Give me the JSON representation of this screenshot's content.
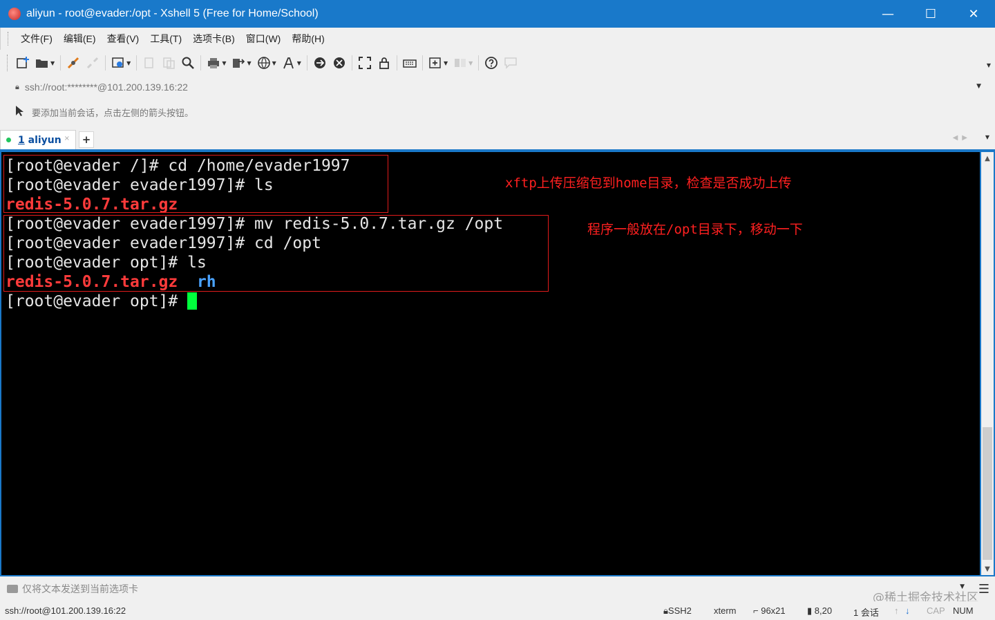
{
  "window": {
    "title": "aliyun - root@evader:/opt - Xshell 5 (Free for Home/School)",
    "minimize": "—",
    "maximize": "☐",
    "close": "✕"
  },
  "menu": [
    "文件(F)",
    "编辑(E)",
    "查看(V)",
    "工具(T)",
    "选项卡(B)",
    "窗口(W)",
    "帮助(H)"
  ],
  "address": {
    "value": "ssh://root:********@101.200.139.16:22"
  },
  "hint": {
    "text": "要添加当前会话，点击左侧的箭头按钮。"
  },
  "tabs": [
    {
      "number": "1",
      "label": "aliyun",
      "close": "×"
    }
  ],
  "new_tab": "+",
  "terminal": {
    "lines": [
      {
        "prompt": "[root@evader /]# ",
        "cmd": "cd /home/evader1997"
      },
      {
        "prompt": "[root@evader evader1997]# ",
        "cmd": "ls"
      },
      {
        "red": "redis-5.0.7.tar.gz"
      },
      {
        "prompt": "[root@evader evader1997]# ",
        "cmd": "mv redis-5.0.7.tar.gz /opt"
      },
      {
        "prompt": "[root@evader evader1997]# ",
        "cmd": "cd /opt"
      },
      {
        "prompt": "[root@evader opt]# ",
        "cmd": "ls"
      },
      {
        "red": "redis-5.0.7.tar.gz",
        "gap": "  ",
        "blue": "rh"
      },
      {
        "prompt": "[root@evader opt]# ",
        "cmd": ""
      }
    ],
    "annotations": [
      "xftp上传压缩包到home目录，检查是否成功上传",
      "程序一般放在/opt目录下，移动一下"
    ],
    "colors": {
      "background": "#000000",
      "text": "#e6e6e6",
      "red": "#ff3b3b",
      "blue": "#4aa3ff",
      "cursor": "#00ff3c",
      "highlight": "#e21b1b"
    }
  },
  "compose": {
    "text": "仅将文本发送到当前选项卡"
  },
  "watermark": "@稀土掘金技术社区",
  "status": {
    "connection": "ssh://root@101.200.139.16:22",
    "protocol": "SSH2",
    "term": "xterm",
    "size": "96x21",
    "cursor_pos": "8,20",
    "sessions": "1 会话",
    "cap": "CAP",
    "num": "NUM"
  },
  "toolbar_icons": [
    "new-session-icon",
    "open-folder-icon",
    "connect-icon",
    "disconnect-icon",
    "properties-icon",
    "copy-icon",
    "paste-icon",
    "find-icon",
    "print-icon",
    "transfer-icon",
    "globe-icon",
    "font-icon",
    "xftp-icon",
    "xmanager-icon",
    "fullscreen-icon",
    "lock-icon",
    "keyboard-icon",
    "compose-icon",
    "layout-icon",
    "help-icon",
    "chat-icon"
  ],
  "accent_color": "#1979ca"
}
